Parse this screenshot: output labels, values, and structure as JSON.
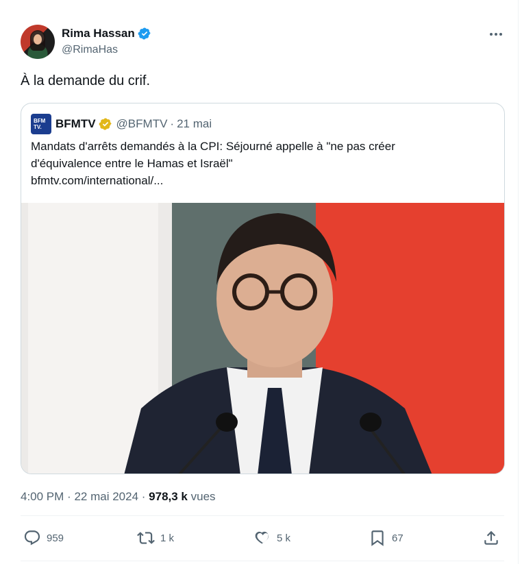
{
  "author": {
    "name": "Rima Hassan",
    "handle": "@RimaHas"
  },
  "icons": {
    "verified": "verified-badge-icon",
    "more": "more-icon",
    "reply": "reply-icon",
    "retweet": "retweet-icon",
    "like": "heart-icon",
    "bookmark": "bookmark-icon",
    "share": "share-icon"
  },
  "tweet": {
    "text": "À la demande du crif."
  },
  "quote": {
    "logo": [
      "BFM",
      "TV."
    ],
    "name": "BFMTV",
    "handle": "@BFMTV",
    "separator": "·",
    "date": "21 mai",
    "line1": "Mandats d'arrêts demandés à la CPI: Séjourné appelle à \"ne pas créer",
    "line2": "d'équivalence entre le Hamas et Israël\"",
    "link": "bfmtv.com/international/..."
  },
  "meta": {
    "time": "4:00 PM",
    "sep1": "·",
    "date": "22 mai 2024",
    "sep2": "·",
    "views": "978,3 k",
    "views_label": "vues"
  },
  "actions": {
    "replies": "959",
    "retweets": "1 k",
    "likes": "5 k",
    "bookmarks": "67"
  },
  "colors": {
    "verified_blue": "#1d9bf0",
    "gold_badge": "#e2b719",
    "secondary_text": "#536471"
  }
}
